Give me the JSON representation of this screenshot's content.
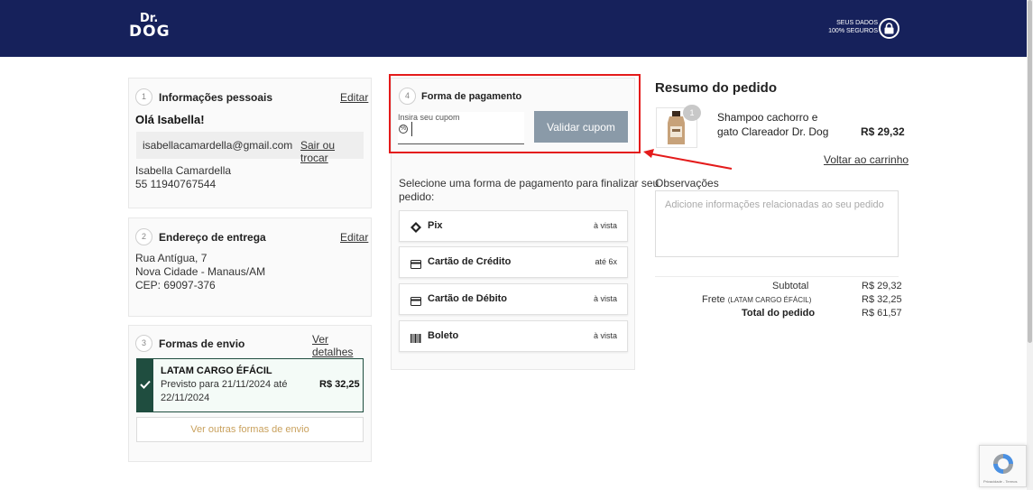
{
  "header": {
    "logo_top": "Dr.",
    "logo_bottom": "DOG",
    "secure_line1": "SEUS DADOS",
    "secure_line2": "100% SEGUROS",
    "color": "#16215b"
  },
  "personal": {
    "step": "1",
    "title": "Informações pessoais",
    "edit_label": "Editar",
    "greeting": "Olá Isabella!",
    "email": "isabellacamardella@gmail.com",
    "switch_label": "Sair ou trocar",
    "name": "Isabella Camardella",
    "phone": "55 11940767544"
  },
  "address": {
    "step": "2",
    "title": "Endereço de entrega",
    "edit_label": "Editar",
    "street": "Rua Antígua, 7",
    "city": "Nova Cidade - Manaus/AM",
    "zip": "CEP: 69097-376"
  },
  "shipping": {
    "step": "3",
    "title": "Formas de envio",
    "details_label": "Ver detalhes",
    "selected": {
      "name": "LATAM CARGO ÉFÁCIL",
      "eta_line1": "Previsto para 21/11/2024 até",
      "eta_line2": "22/11/2024",
      "price": "R$ 32,25"
    },
    "other_label": "Ver outras formas de envio"
  },
  "payment": {
    "step": "4",
    "title": "Forma de pagamento",
    "coupon_label": "Insira seu cupom",
    "coupon_value": "",
    "coupon_button": "Validar cupom",
    "instruction_line1": "Selecione uma forma de pagamento para finalizar seu",
    "instruction_line2": "pedido:",
    "options": [
      {
        "name": "Pix",
        "term": "à vista",
        "icon": "pix-icon"
      },
      {
        "name": "Cartão de Crédito",
        "term": "até 6x",
        "icon": "credit-card-icon"
      },
      {
        "name": "Cartão de Débito",
        "term": "à vista",
        "icon": "debit-card-icon"
      },
      {
        "name": "Boleto",
        "term": "à vista",
        "icon": "barcode-icon"
      }
    ],
    "highlight_color": "#e41b1b"
  },
  "summary": {
    "title": "Resumo do pedido",
    "product": {
      "qty": "1",
      "name_line1": "Shampoo cachorro e",
      "name_line2": "gato Clareador Dr. Dog",
      "price": "R$ 29,32"
    },
    "back_label": "Voltar ao carrinho",
    "notes_label": "Observações",
    "notes_placeholder": "Adicione informações relacionadas ao seu pedido",
    "subtotal_label": "Subtotal",
    "subtotal_value": "R$ 29,32",
    "freight_label": "Frete",
    "freight_carrier": "(LATAM CARGO ÉFÁCIL)",
    "freight_value": "R$ 32,25",
    "total_label": "Total do pedido",
    "total_value": "R$ 61,57"
  },
  "recaptcha": {
    "text": "Privacidade - Termos"
  }
}
